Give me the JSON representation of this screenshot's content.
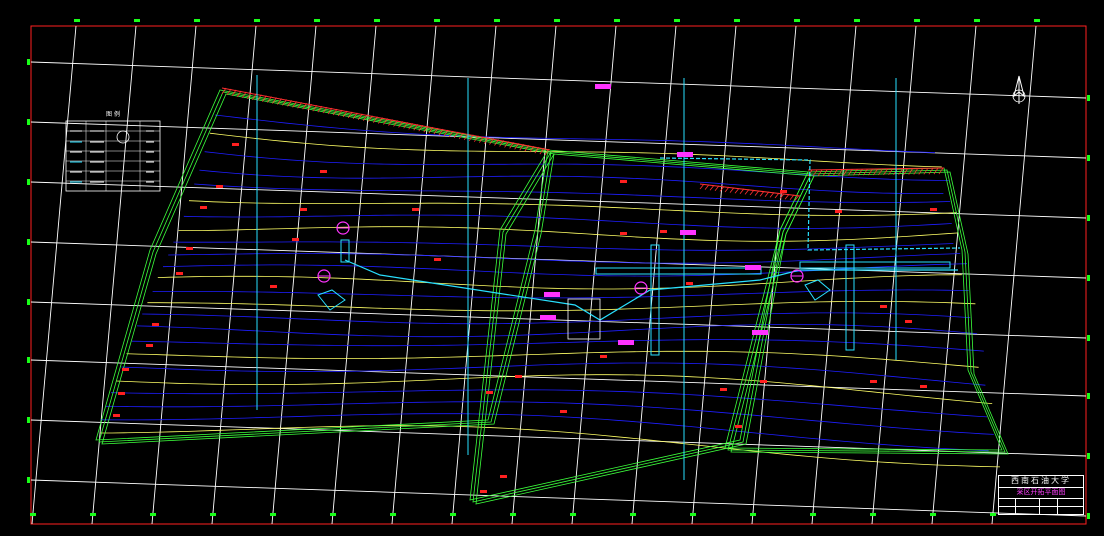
{
  "drawing": {
    "title_block": {
      "school": "西南石油大学",
      "drawing_name": "采区开拓平面图"
    },
    "legend": {
      "title": "图 例"
    },
    "colors": {
      "background": "#000000",
      "frame": "#ff2020",
      "grid": "#ffffff",
      "grid_ticks": "#19ff19",
      "contour_yellow": "#ffff66",
      "contour_blue": "#1e1eff",
      "boundary_green": "#3cff3c",
      "roadway_cyan": "#29e0ff",
      "annotation_magenta": "#ff33ff",
      "label_red": "#ff2020",
      "hatch_red": "#ff3030"
    },
    "icons": [
      "north-arrow-icon",
      "shaft-symbol-icon"
    ]
  }
}
